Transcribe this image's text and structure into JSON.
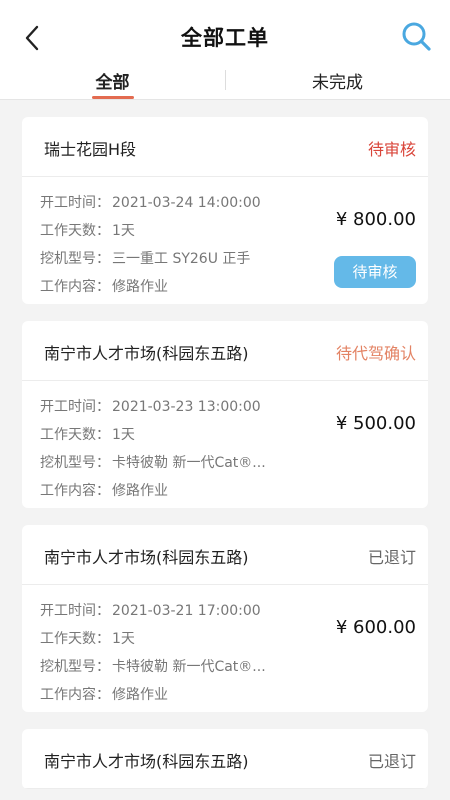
{
  "header": {
    "title": "全部工单",
    "back_icon": "chevron-left-icon",
    "search_icon": "search-icon",
    "accent_color": "#4aa8e0"
  },
  "tabs": [
    {
      "label": "全部",
      "active": true
    },
    {
      "label": "未完成",
      "active": false
    }
  ],
  "field_labels": {
    "start_time": "开工时间：",
    "work_days": "工作天数：",
    "machine_model": "挖机型号：",
    "work_content": "工作内容："
  },
  "orders": [
    {
      "name": "瑞士花园H段",
      "status": "待审核",
      "status_color": "#d9453a",
      "start_time": "2021-03-24 14:00:00",
      "work_days": "1天",
      "machine_model": "三一重工 SY26U 正手",
      "work_content": "修路作业",
      "price": "¥ 800.00",
      "action_label": "待审核"
    },
    {
      "name": "南宁市人才市场(科园东五路)",
      "status": "待代驾确认",
      "status_color": "#e38364",
      "start_time": "2021-03-23 13:00:00",
      "work_days": "1天",
      "machine_model": "卡特彼勒 新一代Cat®...",
      "work_content": "修路作业",
      "price": "¥ 500.00"
    },
    {
      "name": "南宁市人才市场(科园东五路)",
      "status": "已退订",
      "status_color": "#666666",
      "start_time": "2021-03-21 17:00:00",
      "work_days": "1天",
      "machine_model": "卡特彼勒 新一代Cat®...",
      "work_content": "修路作业",
      "price": "¥ 600.00"
    },
    {
      "name": "南宁市人才市场(科园东五路)",
      "status": "已退订",
      "status_color": "#666666"
    }
  ]
}
